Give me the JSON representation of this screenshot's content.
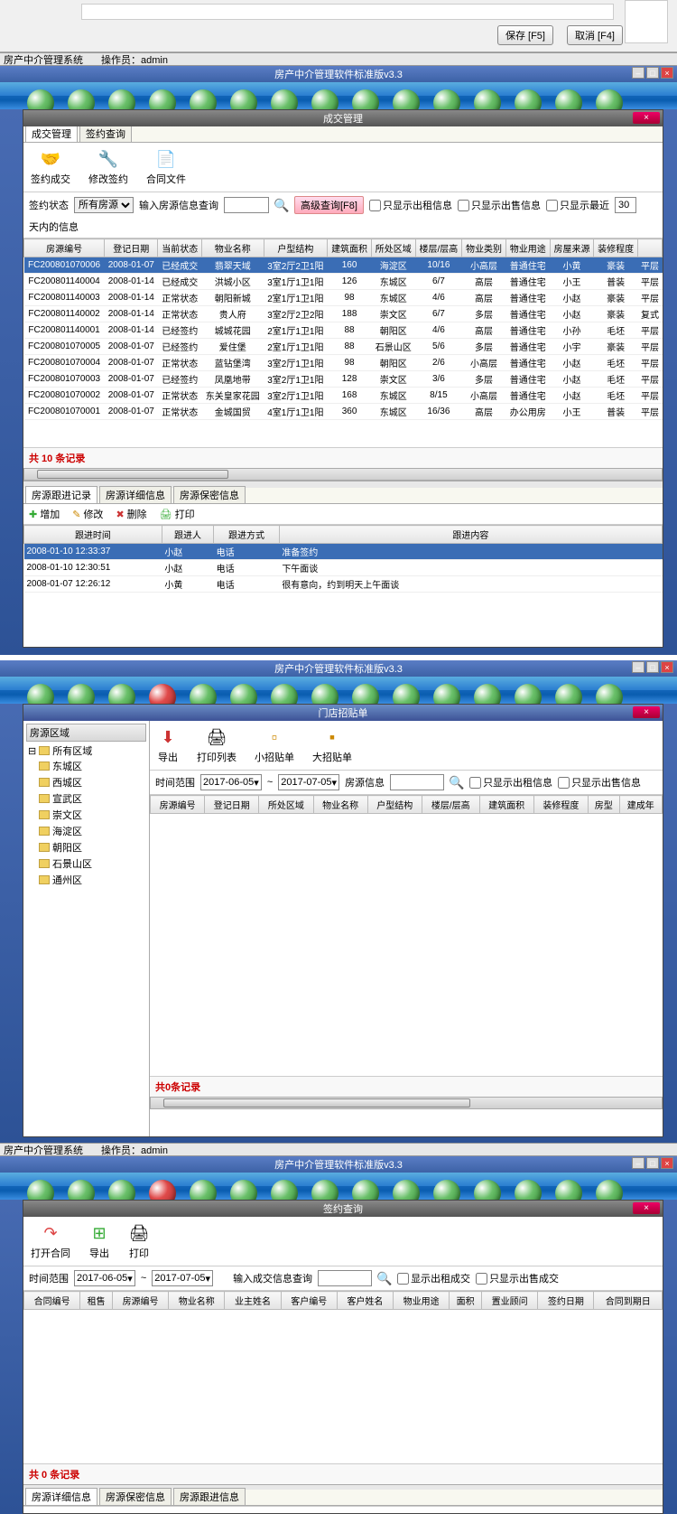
{
  "top_dialog": {
    "save": "保存 [F5]",
    "cancel": "取消 [F4]"
  },
  "status1": {
    "app": "房产中介管理系统",
    "op_label": "操作员：",
    "op": "admin"
  },
  "mdi_title": "房产中介管理软件标准版v3.3",
  "win1": {
    "title": "成交管理",
    "tabs": [
      "成交管理",
      "签约查询"
    ],
    "toolbar": {
      "t1": "签约成交",
      "t2": "修改签约",
      "t3": "合同文件"
    },
    "filter": {
      "status_label": "签约状态",
      "status_value": "所有房源",
      "search_label": "输入房源信息查询",
      "adv": "高级查询[F8]",
      "chk1": "只显示出租信息",
      "chk2": "只显示出售信息",
      "chk3_a": "只显示最近",
      "chk3_days": "30",
      "chk3_b": "天内的信息"
    },
    "cols": [
      "房源编号",
      "登记日期",
      "当前状态",
      "物业名称",
      "户型结构",
      "建筑面积",
      "所处区域",
      "楼层/层高",
      "物业类别",
      "物业用途",
      "房屋来源",
      "装修程度",
      ""
    ],
    "rows": [
      [
        "FC200801070006",
        "2008-01-07",
        "已经成交",
        "翡翠天域",
        "3室2厅2卫1阳",
        "160",
        "海淀区",
        "10/16",
        "小高层",
        "普通住宅",
        "小黄",
        "豪装",
        "平层"
      ],
      [
        "FC200801140004",
        "2008-01-14",
        "已经成交",
        "洪城小区",
        "3室1厅1卫1阳",
        "126",
        "东城区",
        "6/7",
        "高层",
        "普通住宅",
        "小王",
        "普装",
        "平层"
      ],
      [
        "FC200801140003",
        "2008-01-14",
        "正常状态",
        "朝阳新城",
        "2室1厅1卫1阳",
        "98",
        "东城区",
        "4/6",
        "高层",
        "普通住宅",
        "小赵",
        "豪装",
        "平层"
      ],
      [
        "FC200801140002",
        "2008-01-14",
        "正常状态",
        "贵人府",
        "3室2厅2卫2阳",
        "188",
        "崇文区",
        "6/7",
        "多层",
        "普通住宅",
        "小赵",
        "豪装",
        "复式"
      ],
      [
        "FC200801140001",
        "2008-01-14",
        "已经签约",
        "城城花园",
        "2室1厅1卫1阳",
        "88",
        "朝阳区",
        "4/6",
        "高层",
        "普通住宅",
        "小孙",
        "毛坯",
        "平层"
      ],
      [
        "FC200801070005",
        "2008-01-07",
        "已经签约",
        "爱住堡",
        "2室1厅1卫1阳",
        "88",
        "石景山区",
        "5/6",
        "多层",
        "普通住宅",
        "小宇",
        "豪装",
        "平层"
      ],
      [
        "FC200801070004",
        "2008-01-07",
        "正常状态",
        "蓝钻堡湾",
        "3室2厅1卫1阳",
        "98",
        "朝阳区",
        "2/6",
        "小高层",
        "普通住宅",
        "小赵",
        "毛坯",
        "平层"
      ],
      [
        "FC200801070003",
        "2008-01-07",
        "已经签约",
        "凤凰地带",
        "3室2厅1卫1阳",
        "128",
        "崇文区",
        "3/6",
        "多层",
        "普通住宅",
        "小赵",
        "毛坯",
        "平层"
      ],
      [
        "FC200801070002",
        "2008-01-07",
        "正常状态",
        "东关皇家花园",
        "3室2厅1卫1阳",
        "168",
        "东城区",
        "8/15",
        "小高层",
        "普通住宅",
        "小赵",
        "毛坯",
        "平层"
      ],
      [
        "FC200801070001",
        "2008-01-07",
        "正常状态",
        "金城国贸",
        "4室1厅1卫1阳",
        "360",
        "东城区",
        "16/36",
        "高层",
        "办公用房",
        "小王",
        "普装",
        "平层"
      ]
    ],
    "count": "共  10  条记录",
    "subtabs": [
      "房源跟进记录",
      "房源详细信息",
      "房源保密信息"
    ],
    "sub_toolbar": {
      "add": "增加",
      "edit": "修改",
      "del": "删除",
      "print": "打印"
    },
    "sub_cols": [
      "跟进时间",
      "跟进人",
      "跟进方式",
      "跟进内容"
    ],
    "sub_rows": [
      [
        "2008-01-10 12:33:37",
        "小赵",
        "电话",
        "准备签约"
      ],
      [
        "2008-01-10 12:30:51",
        "小赵",
        "电话",
        "下午面谈"
      ],
      [
        "2008-01-07 12:26:12",
        "小黄",
        "电话",
        "很有意向，约到明天上午面谈"
      ]
    ]
  },
  "win2": {
    "title": "门店招贴单",
    "tree_header": "房源区域",
    "tree_root": "所有区域",
    "tree_nodes": [
      "东城区",
      "西城区",
      "宣武区",
      "崇文区",
      "海淀区",
      "朝阳区",
      "石景山区",
      "通州区"
    ],
    "toolbar": {
      "t1": "导出",
      "t2": "打印列表",
      "t3": "小招贴单",
      "t4": "大招贴单"
    },
    "filter": {
      "range_label": "时间范围",
      "from": "2017-06-05",
      "to": "2017-07-05",
      "info_label": "房源信息",
      "chk1": "只显示出租信息",
      "chk2": "只显示出售信息"
    },
    "cols": [
      "房源编号",
      "登记日期",
      "所处区域",
      "物业名称",
      "户型结构",
      "楼层/层高",
      "建筑面积",
      "装修程度",
      "房型",
      "建成年"
    ],
    "count": "共0条记录"
  },
  "status2": {
    "app": "房产中介管理系统",
    "op_label": "操作员：",
    "op": "admin"
  },
  "win3": {
    "title": "签约查询",
    "toolbar": {
      "t1": "打开合同",
      "t2": "导出",
      "t3": "打印"
    },
    "filter": {
      "range_label": "时间范围",
      "from": "2017-06-05",
      "to": "2017-07-05",
      "search_label": "输入成交信息查询",
      "chk1": "显示出租成交",
      "chk2": "只显示出售成交"
    },
    "cols": [
      "合同编号",
      "租售",
      "房源编号",
      "物业名称",
      "业主姓名",
      "客户编号",
      "客户姓名",
      "物业用途",
      "面积",
      "置业顾问",
      "签约日期",
      "合同到期日"
    ],
    "count": "共  0  条记录",
    "subtabs": [
      "房源详细信息",
      "房源保密信息",
      "房源跟进信息"
    ]
  }
}
